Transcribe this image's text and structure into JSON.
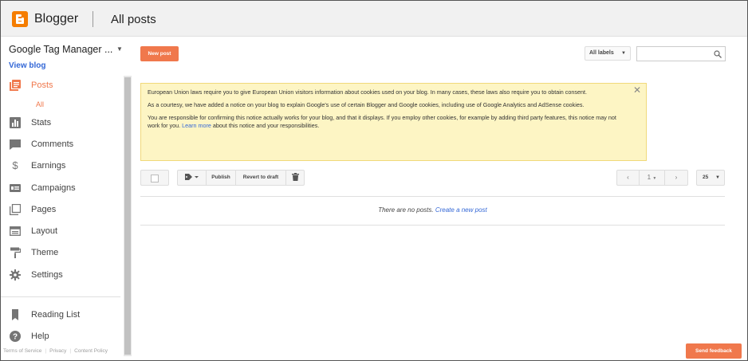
{
  "header": {
    "app_name": "Blogger",
    "page_title": "All posts"
  },
  "sidebar": {
    "blog_name": "Google Tag Manager ...",
    "view_blog": "View blog",
    "items": [
      {
        "label": "Posts",
        "icon": "posts-icon",
        "active": true
      },
      {
        "label": "Stats",
        "icon": "stats-icon"
      },
      {
        "label": "Comments",
        "icon": "comments-icon"
      },
      {
        "label": "Earnings",
        "icon": "dollar-icon"
      },
      {
        "label": "Campaigns",
        "icon": "campaigns-icon"
      },
      {
        "label": "Pages",
        "icon": "pages-icon"
      },
      {
        "label": "Layout",
        "icon": "layout-icon"
      },
      {
        "label": "Theme",
        "icon": "paint-roller-icon"
      },
      {
        "label": "Settings",
        "icon": "gear-icon"
      }
    ],
    "sub_all": "All",
    "bottom_items": [
      {
        "label": "Reading List",
        "icon": "bookmark-icon"
      },
      {
        "label": "Help",
        "icon": "help-icon"
      }
    ],
    "footer": {
      "terms": "Terms of Service",
      "privacy": "Privacy",
      "content_policy": "Content Policy"
    }
  },
  "toolbar": {
    "new_post": "New post",
    "labels_filter": "All labels",
    "search_placeholder": ""
  },
  "notice": {
    "p1": "European Union laws require you to give European Union visitors information about cookies used on your blog. In many cases, these laws also require you to obtain consent.",
    "p2": "As a courtesy, we have added a notice on your blog to explain Google's use of certain Blogger and Google cookies, including use of Google Analytics and AdSense cookies.",
    "p3_before": "You are responsible for confirming this notice actually works for your blog, and that it displays. If you employ other cookies, for example by adding third party features, this notice may not work for you.",
    "p3_link": "Learn more",
    "p3_after": "about this notice and your responsibilities.",
    "close": "✕"
  },
  "actions": {
    "publish": "Publish",
    "revert": "Revert to draft"
  },
  "pager": {
    "page": "1",
    "per_page": "25"
  },
  "empty": {
    "text": "There are no posts.",
    "link": "Create a new post"
  },
  "feedback": "Send feedback",
  "colors": {
    "accent": "#f0784c",
    "logo": "#f57d00",
    "notice_bg": "#fdf5c4",
    "link": "#3367d6"
  }
}
